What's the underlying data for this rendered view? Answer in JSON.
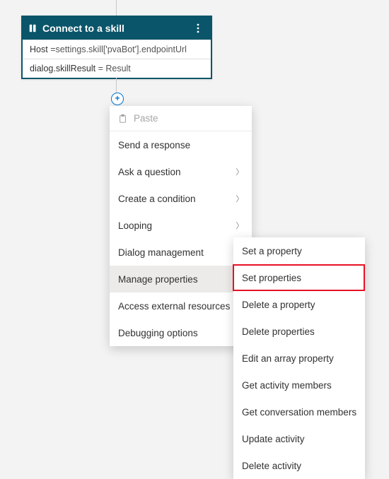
{
  "card": {
    "title": "Connect to a skill",
    "row1_prefix": "Host ",
    "row1_value": "=settings.skill['pvaBot'].endpointUrl",
    "row2_prefix": "dialog.skillResult ",
    "row2_value": "= Result"
  },
  "menu": {
    "paste": "Paste",
    "items": [
      {
        "label": "Send a response",
        "has_sub": false
      },
      {
        "label": "Ask a question",
        "has_sub": true
      },
      {
        "label": "Create a condition",
        "has_sub": true
      },
      {
        "label": "Looping",
        "has_sub": true
      },
      {
        "label": "Dialog management",
        "has_sub": true
      },
      {
        "label": "Manage properties",
        "has_sub": true,
        "hovered": true
      },
      {
        "label": "Access external resources",
        "has_sub": true
      },
      {
        "label": "Debugging options",
        "has_sub": true
      }
    ]
  },
  "submenu": {
    "items": [
      "Set a property",
      "Set properties",
      "Delete a property",
      "Delete properties",
      "Edit an array property",
      "Get activity members",
      "Get conversation members",
      "Update activity",
      "Delete activity"
    ]
  }
}
